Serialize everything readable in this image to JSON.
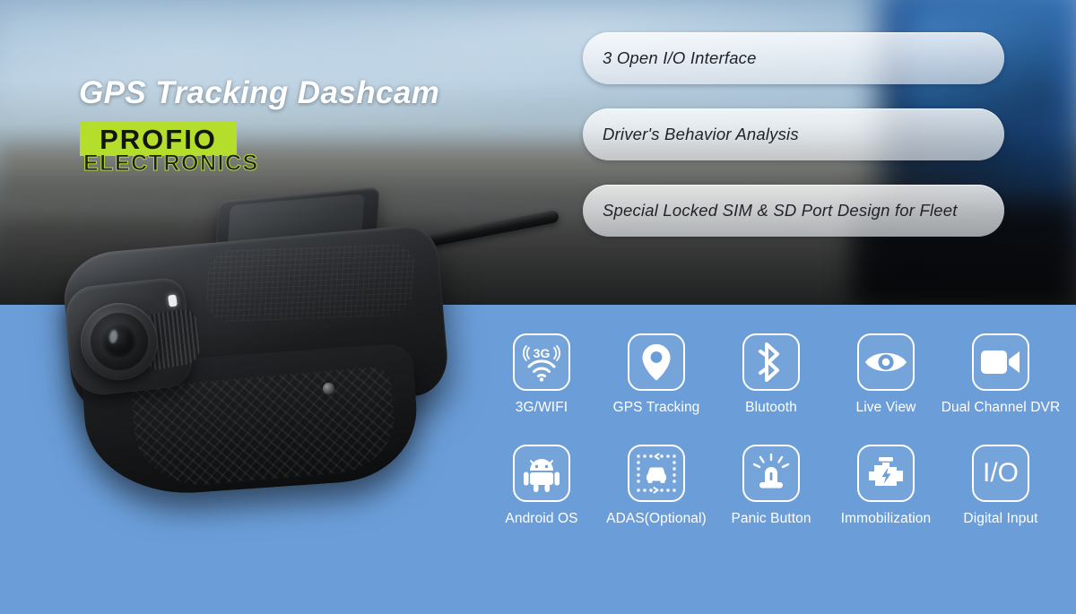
{
  "banner": {
    "headline": "GPS Tracking Dashcam",
    "brand": {
      "name": "PROFIO",
      "subtitle": "ELECTRONICS",
      "accent_color": "#b5dd2b",
      "text_color": "#121512"
    },
    "panel_color": "#6b9ed9",
    "product": {
      "name": "gps-tracking-dashcam",
      "color": "#1c1e20"
    }
  },
  "features": [
    {
      "label": "3 Open I/O Interface"
    },
    {
      "label": "Driver's Behavior Analysis"
    },
    {
      "label": "Special Locked SIM & SD Port Design for Fleet"
    }
  ],
  "icons": {
    "row1": [
      {
        "icon": "3g-wifi-icon",
        "label": "3G/WIFI",
        "badge": "3G"
      },
      {
        "icon": "map-pin-icon",
        "label": "GPS Tracking"
      },
      {
        "icon": "bluetooth-icon",
        "label": "Blutooth"
      },
      {
        "icon": "eye-icon",
        "label": "Live View"
      },
      {
        "icon": "video-camera-icon",
        "label": "Dual Channel DVR"
      }
    ],
    "row2": [
      {
        "icon": "android-icon",
        "label": "Android OS"
      },
      {
        "icon": "adas-car-icon",
        "label": "ADAS(Optional)"
      },
      {
        "icon": "siren-icon",
        "label": "Panic Button"
      },
      {
        "icon": "engine-bolt-icon",
        "label": "Immobilization"
      },
      {
        "icon": "io-text-icon",
        "label": "Digital Input",
        "glyph": "I/O"
      }
    ]
  }
}
